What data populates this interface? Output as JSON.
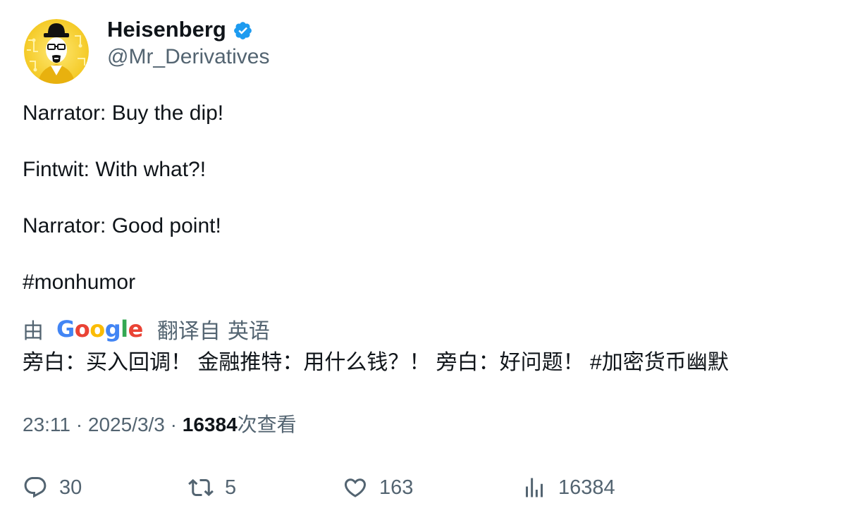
{
  "author": {
    "display_name": "Heisenberg",
    "handle": "@Mr_Derivatives",
    "verified": true,
    "avatar_icon": "heisenberg-avatar",
    "verified_color": "#1d9bf0",
    "avatar_color": "#f5c518"
  },
  "tweet": {
    "lines": [
      "Narrator: Buy the dip!",
      "Fintwit: With what?!",
      "Narrator: Good point!",
      "#monhumor"
    ]
  },
  "translation": {
    "prefix": "由",
    "provider": "Google",
    "label": "翻译自",
    "language": "英语",
    "text": "旁白：买入回调！ 金融推特：用什么钱？！ 旁白：好问题！ #加密货币幽默"
  },
  "meta": {
    "time": "23:11",
    "separator": "·",
    "date": "2025/3/3",
    "views": "16384",
    "views_label": "次查看"
  },
  "actions": {
    "replies": "30",
    "retweets": "5",
    "likes": "163",
    "views": "16384"
  },
  "colors": {
    "text": "#0f1419",
    "secondary": "#536471",
    "google_blue": "#4285f4",
    "google_red": "#ea4335",
    "google_yellow": "#fbbc05",
    "google_green": "#34a853"
  }
}
